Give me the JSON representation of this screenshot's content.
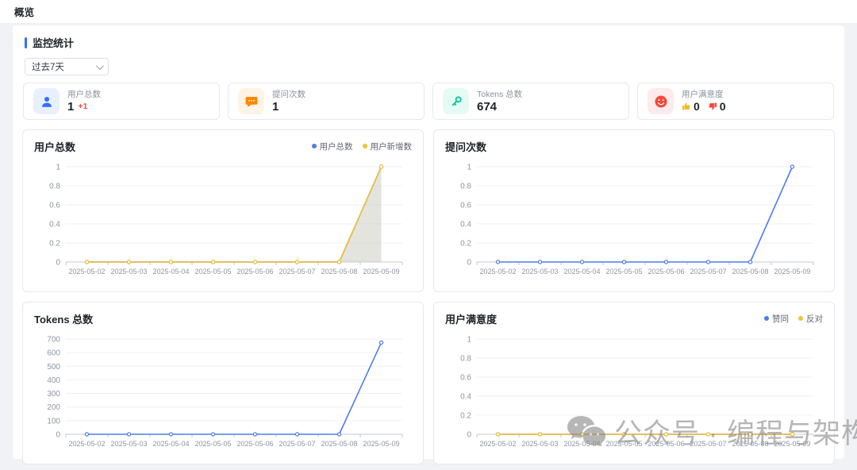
{
  "page": {
    "title": "概览"
  },
  "section": {
    "title": "监控统计"
  },
  "filter": {
    "value": "过去7天"
  },
  "stats": [
    {
      "icon": "user-icon",
      "label": "用户总数",
      "value": "1",
      "delta": "+1"
    },
    {
      "icon": "chat-bubble-icon",
      "label": "提问次数",
      "value": "1"
    },
    {
      "icon": "key-icon",
      "label": "Tokens 总数",
      "value": "674"
    },
    {
      "icon": "smiley-icon",
      "label": "用户满意度",
      "up_value": "0",
      "down_value": "0"
    }
  ],
  "colors": {
    "accent_blue": "#3370ff",
    "series_blue": "#4e7cee",
    "series_yellow": "#f3c233",
    "delta_red": "#f5483b",
    "icon_orange": "#ff8800",
    "icon_teal": "#12c2a0",
    "icon_red": "#f5483b",
    "thumb_up_yellow": "#f7ba1e",
    "thumb_down_red": "#f5483b"
  },
  "watermark": {
    "text": "公众号 · 编程与架构",
    "icon": "wechat-icon"
  },
  "chart_data": [
    {
      "type": "line",
      "title": "用户总数",
      "legend": [
        {
          "label": "用户总数",
          "color": "#4e7cee"
        },
        {
          "label": "用户新增数",
          "color": "#f3c233"
        }
      ],
      "categories": [
        "2025-05-02",
        "2025-05-03",
        "2025-05-04",
        "2025-05-05",
        "2025-05-06",
        "2025-05-07",
        "2025-05-08",
        "2025-05-09"
      ],
      "series": [
        {
          "name": "用户总数",
          "color": "#4e7cee",
          "values": [
            0,
            0,
            0,
            0,
            0,
            0,
            0,
            1
          ],
          "area": "rgba(196,196,184,0.45)"
        },
        {
          "name": "用户新增数",
          "color": "#f3c233",
          "values": [
            0,
            0,
            0,
            0,
            0,
            0,
            0,
            1
          ]
        }
      ],
      "ylim": [
        0,
        1
      ],
      "yticks": [
        0,
        0.2,
        0.4,
        0.6,
        0.8,
        1
      ],
      "xlabel": "",
      "ylabel": "",
      "grid": true,
      "legend_position": "top-right"
    },
    {
      "type": "line",
      "title": "提问次数",
      "legend": [],
      "categories": [
        "2025-05-02",
        "2025-05-03",
        "2025-05-04",
        "2025-05-05",
        "2025-05-06",
        "2025-05-07",
        "2025-05-08",
        "2025-05-09"
      ],
      "series": [
        {
          "name": "提问次数",
          "color": "#4e7cee",
          "values": [
            0,
            0,
            0,
            0,
            0,
            0,
            0,
            1
          ]
        }
      ],
      "ylim": [
        0,
        1
      ],
      "yticks": [
        0,
        0.2,
        0.4,
        0.6,
        0.8,
        1
      ],
      "xlabel": "",
      "ylabel": "",
      "grid": true
    },
    {
      "type": "line",
      "title": "Tokens 总数",
      "legend": [],
      "categories": [
        "2025-05-02",
        "2025-05-03",
        "2025-05-04",
        "2025-05-05",
        "2025-05-06",
        "2025-05-07",
        "2025-05-08",
        "2025-05-09"
      ],
      "series": [
        {
          "name": "Tokens 总数",
          "color": "#4e7cee",
          "values": [
            0,
            0,
            0,
            0,
            0,
            0,
            0,
            674
          ]
        }
      ],
      "ylim": [
        0,
        700
      ],
      "yticks": [
        0,
        100,
        200,
        300,
        400,
        500,
        600,
        700
      ],
      "xlabel": "",
      "ylabel": "",
      "grid": true
    },
    {
      "type": "line",
      "title": "用户满意度",
      "legend": [
        {
          "label": "赞同",
          "color": "#4e7cee"
        },
        {
          "label": "反对",
          "color": "#f3c233"
        }
      ],
      "categories": [
        "2025-05-02",
        "2025-05-03",
        "2025-05-04",
        "2025-05-05",
        "2025-05-06",
        "2025-05-07",
        "2025-05-08",
        "2025-05-09"
      ],
      "series": [
        {
          "name": "赞同",
          "color": "#4e7cee",
          "values": [
            0,
            0,
            0,
            0,
            0,
            0,
            0,
            0
          ]
        },
        {
          "name": "反对",
          "color": "#f3c233",
          "values": [
            0,
            0,
            0,
            0,
            0,
            0,
            0,
            0
          ]
        }
      ],
      "ylim": [
        0,
        1
      ],
      "yticks": [
        0,
        0.2,
        0.4,
        0.6,
        0.8,
        1
      ],
      "xlabel": "",
      "ylabel": "",
      "grid": true,
      "legend_position": "top-right"
    }
  ]
}
